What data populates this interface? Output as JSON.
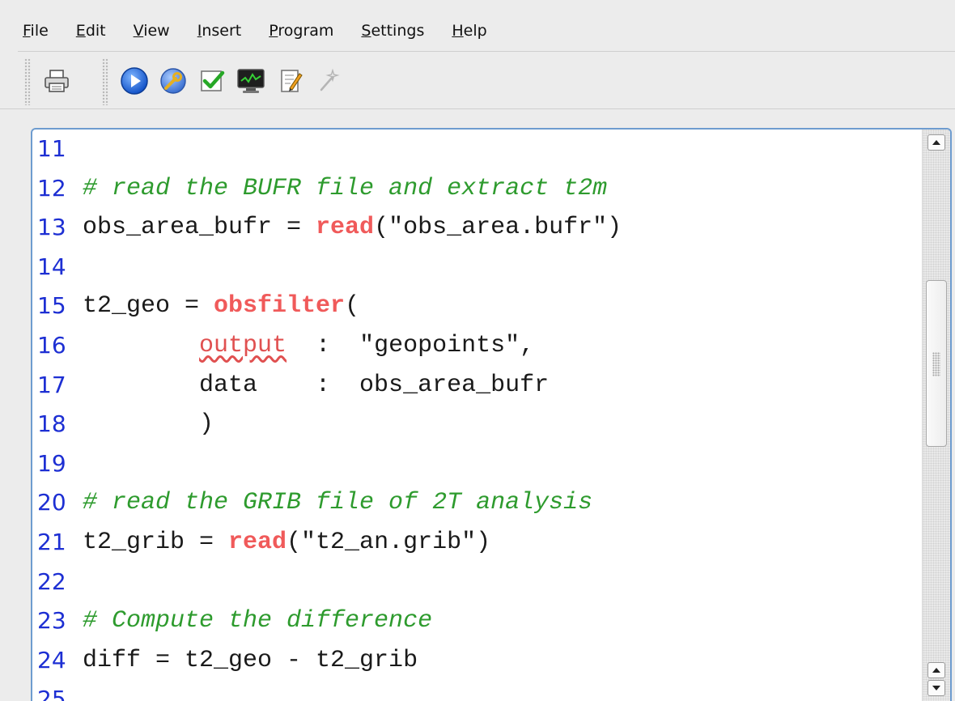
{
  "menubar": {
    "items": [
      {
        "mnemonic": "F",
        "rest": "ile"
      },
      {
        "mnemonic": "E",
        "rest": "dit"
      },
      {
        "mnemonic": "V",
        "rest": "iew"
      },
      {
        "mnemonic": "I",
        "rest": "nsert"
      },
      {
        "mnemonic": "P",
        "rest": "rogram"
      },
      {
        "mnemonic": "S",
        "rest": "ettings"
      },
      {
        "mnemonic": "H",
        "rest": "elp"
      }
    ]
  },
  "toolbar": {
    "icons": [
      "printer-icon",
      "play-icon",
      "wrench-globe-icon",
      "check-document-icon",
      "monitor-chart-icon",
      "edit-document-icon",
      "magic-wand-icon"
    ]
  },
  "editor": {
    "lines": [
      {
        "num": "11",
        "parts": []
      },
      {
        "num": "12",
        "parts": [
          {
            "t": "# read the BUFR file and extract t2m",
            "c": "comment"
          }
        ]
      },
      {
        "num": "13",
        "parts": [
          {
            "t": "obs_area_bufr = ",
            "c": "plain"
          },
          {
            "t": "read",
            "c": "kw"
          },
          {
            "t": "(\"obs_area.bufr\")",
            "c": "plain"
          }
        ]
      },
      {
        "num": "14",
        "parts": []
      },
      {
        "num": "15",
        "parts": [
          {
            "t": "t2_geo = ",
            "c": "plain"
          },
          {
            "t": "obsfilter",
            "c": "kw"
          },
          {
            "t": "(",
            "c": "plain"
          }
        ]
      },
      {
        "num": "16",
        "parts": [
          {
            "t": "        ",
            "c": "plain"
          },
          {
            "t": "output",
            "c": "squiggle"
          },
          {
            "t": "  :  \"geopoints\",",
            "c": "plain"
          }
        ]
      },
      {
        "num": "17",
        "parts": [
          {
            "t": "        data    :  obs_area_bufr",
            "c": "plain"
          }
        ]
      },
      {
        "num": "18",
        "parts": [
          {
            "t": "        )",
            "c": "plain"
          }
        ]
      },
      {
        "num": "19",
        "parts": []
      },
      {
        "num": "20",
        "parts": [
          {
            "t": "# read the GRIB file of 2T analysis",
            "c": "comment"
          }
        ]
      },
      {
        "num": "21",
        "parts": [
          {
            "t": "t2_grib = ",
            "c": "plain"
          },
          {
            "t": "read",
            "c": "kw"
          },
          {
            "t": "(\"t2_an.grib\")",
            "c": "plain"
          }
        ]
      },
      {
        "num": "22",
        "parts": []
      },
      {
        "num": "23",
        "parts": [
          {
            "t": "# Compute the difference",
            "c": "comment"
          }
        ]
      },
      {
        "num": "24",
        "parts": [
          {
            "t": "diff = t2_geo - t2_grib",
            "c": "plain"
          }
        ]
      },
      {
        "num": "25",
        "parts": []
      }
    ]
  },
  "colors": {
    "line_number": "#1d2fd3",
    "comment": "#2e9b2e",
    "keyword": "#f05a5a",
    "editor_border": "#6e9ccf"
  }
}
